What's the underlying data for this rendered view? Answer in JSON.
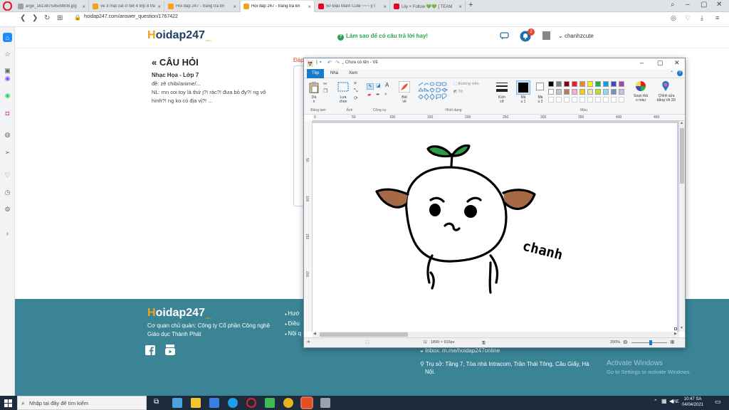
{
  "browser": {
    "tabs": [
      {
        "label": "arge_1613875d5d9808.jpg",
        "icon_color": "#9aa0a6",
        "active": false
      },
      {
        "label": "vẽ 3 mặt cắt ở tiết 4 lớp 8 thành",
        "icon_color": "#f2a31b",
        "active": false
      },
      {
        "label": "Hỏi đáp 247 - trang tra lời",
        "icon_color": "#f2a31b",
        "active": false
      },
      {
        "label": "Hỏi đáp 247 - trang tra lời",
        "icon_color": "#f2a31b",
        "active": true
      },
      {
        "label": "50 Đậu Mầm Cute ~~~ ý t",
        "icon_color": "#e60023",
        "active": false
      },
      {
        "label": "Lily × Follow 💚💚 [ TEAM",
        "icon_color": "#e60023",
        "active": false
      }
    ],
    "url": "hoidap247.com/answer_question/1767422"
  },
  "site": {
    "logo_h": "H",
    "logo_rest": "oidap247",
    "logo_com": ".com",
    "tagline_icon": "?",
    "tagline": "Làm sao để có câu trả lời hay!",
    "notif_count": "2",
    "username": "chanhzcute"
  },
  "question": {
    "title": "CÂU HỎI",
    "subject": "Nhạc Họa - Lớp 7",
    "line1": "đề: zẽ chibi/anime/...",
    "line2": "NL: mn coi toy lá thứ j?! rác?! đưa bỏ đy?! ng vô",
    "line3": "hình?! ng ko có địa vị?! ...",
    "peek_label": "Đáp"
  },
  "footer": {
    "owner_line1": "Cơ quan chủ quản: Công ty Cổ phần Công nghệ",
    "owner_line2": "Giáo dục Thành Phát",
    "links": [
      "Hướ",
      "Điều",
      "Nội q"
    ],
    "inbox": "Inbox: m.me/hoidap247online",
    "address_line1": "Trụ sở: Tầng 7, Tòa nhà Intracom, Trần Thái Tông, Cầu Giấy, Hà",
    "address_line2": "Nội.",
    "activate_title": "Activate Windows",
    "activate_sub": "Go to Settings to activate Windows."
  },
  "paint": {
    "title": "Chưa có tên - Vẽ",
    "tabs": [
      "Tệp",
      "Nhà",
      "Xem"
    ],
    "groups": {
      "clipboard": "Bảng tạm",
      "image": "Ảnh",
      "tools": "Công cụ",
      "shapes": "Hình dạng",
      "colors": "Màu"
    },
    "labels": {
      "paste": "Dá\nn",
      "select": "Lựa\nchọn",
      "brushes": "Bút\nvẽ",
      "outline": "Đường viền",
      "fill": "Tô",
      "size": "Kích\ncỡ",
      "color1": "Mà\nu 1",
      "color2": "Mà\nu 2",
      "edit_colors": "Soạn thả\no màu",
      "paint3d": "Chỉnh sửa\nbằng Vẽ 3D"
    },
    "ruler_h": [
      "0",
      "50",
      "100",
      "150",
      "200",
      "250",
      "300",
      "350",
      "400",
      "450"
    ],
    "ruler_v": [
      "50",
      "100",
      "150",
      "200"
    ],
    "palette_row1": [
      "#000000",
      "#7f7f7f",
      "#880015",
      "#ed1c24",
      "#ff7f27",
      "#fff200",
      "#22b14c",
      "#00a2e8",
      "#3f48cc",
      "#a349a4"
    ],
    "palette_row2": [
      "#ffffff",
      "#c3c3c3",
      "#b97a57",
      "#ffaec9",
      "#ffc90e",
      "#efe4b0",
      "#b5e61d",
      "#99d9ea",
      "#7092be",
      "#c8bfe7"
    ],
    "signature": "chanh",
    "status_size": "1890 × 916px",
    "zoom": "200%"
  },
  "taskbar": {
    "search_placeholder": "Nhập tại đây để tìm kiếm",
    "lang": "VIE",
    "time": "10:47 SA",
    "date": "04/04/2021"
  }
}
